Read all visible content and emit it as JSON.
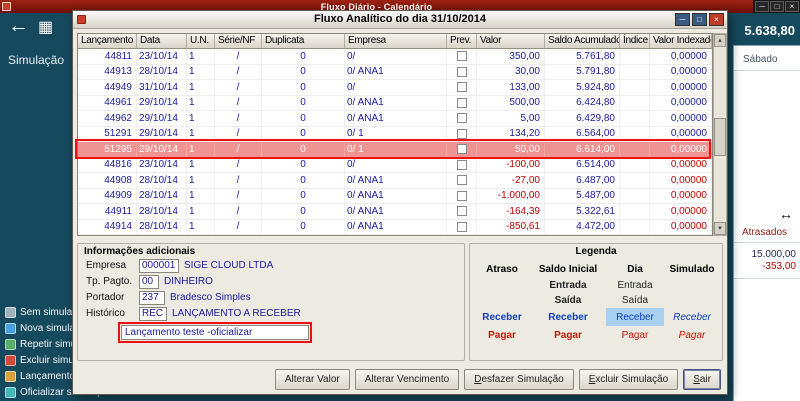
{
  "icons": {
    "minimize": "─",
    "maximize": "□",
    "close": "×",
    "back": "←",
    "calculator": "▦",
    "resize_horizontal": "↔",
    "scroll_up": "▲",
    "scroll_down": "▼"
  },
  "colors": {
    "highlight_row": "#f09393",
    "annotation_red": "#f01010",
    "value_blue": "#1a1aa0",
    "value_negative_red": "#c00000",
    "legend_day_highlight": "#a9d1f2",
    "main_titlebar_maroon": "#8f1a0f"
  },
  "background": {
    "window_title": "Fluxo Diário - Calendário",
    "nav_section_label": "Simulação",
    "header_value": "5.638,80",
    "menu_items": [
      {
        "label": "Sem simulação",
        "icon": "no-simulation-icon"
      },
      {
        "label": "Nova simulação",
        "icon": "new-simulation-icon"
      },
      {
        "label": "Repetir simulação",
        "icon": "repeat-simulation-icon"
      },
      {
        "label": "Excluir simulação",
        "icon": "delete-simulation-icon"
      },
      {
        "label": "Lançamentos",
        "icon": "entries-icon"
      },
      {
        "label": "Oficializar simulação",
        "icon": "officialize-icon"
      }
    ],
    "right_panel": {
      "day_label": "Sábado",
      "overdue_label": "Atrasados",
      "overdue_total": "15.000,00",
      "overdue_balance": "-353,00"
    }
  },
  "dialog": {
    "title": "Fluxo Analítico do dia 31/10/2014",
    "table": {
      "columns": [
        "Lançamento",
        "Data",
        "U.N.",
        "Série/NF",
        "Duplicata",
        "Empresa",
        "Prev.",
        "Valor",
        "Saldo Acumulado",
        "Índice",
        "Valor Indexado"
      ],
      "rows": [
        {
          "lancamento": "44811",
          "data": "23/10/14",
          "un": "1",
          "serie": "/",
          "duplicata": "0",
          "empresa": "0/",
          "valor": "350,00",
          "saldo": "5.761,80",
          "indice": "",
          "indexado": "0,00000",
          "highlight": false
        },
        {
          "lancamento": "44913",
          "data": "28/10/14",
          "un": "1",
          "serie": "/",
          "duplicata": "0",
          "empresa": "0/ ANA1",
          "valor": "30,00",
          "saldo": "5.791,80",
          "indice": "",
          "indexado": "0,00000",
          "highlight": false
        },
        {
          "lancamento": "44949",
          "data": "31/10/14",
          "un": "1",
          "serie": "/",
          "duplicata": "0",
          "empresa": "0/",
          "valor": "133,00",
          "saldo": "5.924,80",
          "indice": "",
          "indexado": "0,00000",
          "highlight": false
        },
        {
          "lancamento": "44961",
          "data": "29/10/14",
          "un": "1",
          "serie": "/",
          "duplicata": "0",
          "empresa": "0/ ANA1",
          "valor": "500,00",
          "saldo": "6.424,80",
          "indice": "",
          "indexado": "0,00000",
          "highlight": false
        },
        {
          "lancamento": "44962",
          "data": "29/10/14",
          "un": "1",
          "serie": "/",
          "duplicata": "0",
          "empresa": "0/ ANA1",
          "valor": "5,00",
          "saldo": "6.429,80",
          "indice": "",
          "indexado": "0,00000",
          "highlight": false
        },
        {
          "lancamento": "51291",
          "data": "29/10/14",
          "un": "1",
          "serie": "/",
          "duplicata": "0",
          "empresa": "0/ 1",
          "valor": "134,20",
          "saldo": "6.564,00",
          "indice": "",
          "indexado": "0,00000",
          "highlight": false
        },
        {
          "lancamento": "51295",
          "data": "29/10/14",
          "un": "1",
          "serie": "/",
          "duplicata": "0",
          "empresa": "0/ 1",
          "valor": "50,00",
          "saldo": "6.614,00",
          "indice": "",
          "indexado": "0,00000",
          "highlight": true
        },
        {
          "lancamento": "44816",
          "data": "23/10/14",
          "un": "1",
          "serie": "/",
          "duplicata": "0",
          "empresa": "0/",
          "valor": "-100,00",
          "saldo": "6.514,00",
          "indice": "",
          "indexado": "0,00000",
          "highlight": false
        },
        {
          "lancamento": "44908",
          "data": "28/10/14",
          "un": "1",
          "serie": "/",
          "duplicata": "0",
          "empresa": "0/ ANA1",
          "valor": "-27,00",
          "saldo": "6.487,00",
          "indice": "",
          "indexado": "0,00000",
          "highlight": false
        },
        {
          "lancamento": "44909",
          "data": "28/10/14",
          "un": "1",
          "serie": "/",
          "duplicata": "0",
          "empresa": "0/ ANA1",
          "valor": "-1.000,00",
          "saldo": "5.487,00",
          "indice": "",
          "indexado": "0,00000",
          "highlight": false
        },
        {
          "lancamento": "44911",
          "data": "28/10/14",
          "un": "1",
          "serie": "/",
          "duplicata": "0",
          "empresa": "0/ ANA1",
          "valor": "-164,39",
          "saldo": "5.322,61",
          "indice": "",
          "indexado": "0,00000",
          "highlight": false
        },
        {
          "lancamento": "44914",
          "data": "28/10/14",
          "un": "1",
          "serie": "/",
          "duplicata": "0",
          "empresa": "0/ ANA1",
          "valor": "-850,61",
          "saldo": "4.472,00",
          "indice": "",
          "indexado": "0,00000",
          "highlight": false
        }
      ]
    },
    "info": {
      "title": "Informações adicionais",
      "fields": [
        {
          "label": "Empresa",
          "code": "000001",
          "desc": "SIGE CLOUD LTDA"
        },
        {
          "label": "Tp. Pagto.",
          "code": "00",
          "desc": "DINHEIRO"
        },
        {
          "label": "Portador",
          "code": "237",
          "desc": "Bradesco Simples"
        },
        {
          "label": "Histórico",
          "code": "REC",
          "desc": "LANÇAMENTO A RECEBER"
        }
      ],
      "note": "Lançamento teste -oficializar"
    },
    "legend": {
      "title": "Legenda",
      "headers": [
        "Atraso",
        "Saldo Inicial",
        "Dia",
        "Simulado"
      ],
      "grid": [
        [
          "",
          "Entrada",
          "Entrada",
          ""
        ],
        [
          "",
          "Saída",
          "Saída",
          ""
        ],
        [
          "Receber",
          "Receber",
          "Receber",
          "Receber"
        ],
        [
          "Pagar",
          "Pagar",
          "Pagar",
          "Pagar"
        ]
      ]
    },
    "buttons": [
      {
        "label": "Alterar Valor",
        "underline_first": false
      },
      {
        "label": "Alterar Vencimento",
        "underline_first": false
      },
      {
        "label": "Desfazer Simulação",
        "underline_first": true
      },
      {
        "label": "Excluir Simulação",
        "underline_first": true
      },
      {
        "label": "Sair",
        "underline_first": true
      }
    ]
  }
}
